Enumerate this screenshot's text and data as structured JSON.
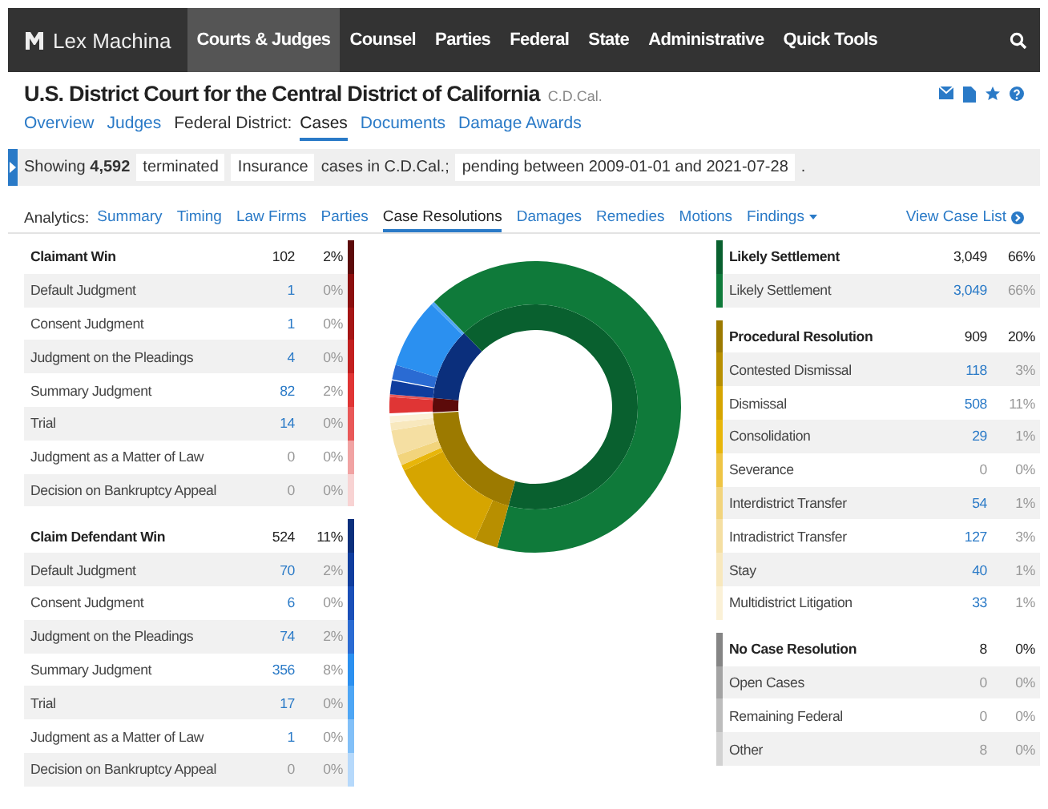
{
  "nav": {
    "logo": "Lex Machina",
    "items": [
      {
        "label": "Courts & Judges",
        "selected": true
      },
      {
        "label": "Counsel",
        "selected": false
      },
      {
        "label": "Parties",
        "selected": false
      },
      {
        "label": "Federal",
        "selected": false
      },
      {
        "label": "State",
        "selected": false
      },
      {
        "label": "Administrative",
        "selected": false
      },
      {
        "label": "Quick Tools",
        "selected": false
      }
    ]
  },
  "header": {
    "title": "U.S. District Court for the Central District of California",
    "abbreviation": "C.D.Cal.",
    "tabs": [
      {
        "kind": "link",
        "label": "Overview",
        "selected": false
      },
      {
        "kind": "link",
        "label": "Judges",
        "selected": false
      },
      {
        "kind": "label",
        "label": "Federal District:"
      },
      {
        "kind": "link",
        "label": "Cases",
        "selected": true
      },
      {
        "kind": "link",
        "label": "Documents",
        "selected": false
      },
      {
        "kind": "link",
        "label": "Damage Awards",
        "selected": false
      }
    ]
  },
  "filter": [
    {
      "kind": "text",
      "text": "Showing **4,592**"
    },
    {
      "kind": "chip",
      "text": "terminated"
    },
    {
      "kind": "chip",
      "text": "Insurance"
    },
    {
      "kind": "text",
      "text": "cases in C.D.Cal.;"
    },
    {
      "kind": "chip",
      "text": "pending between 2009-01-01 and 2021-07-28"
    },
    {
      "kind": "text",
      "text": "."
    }
  ],
  "analytics": {
    "label": "Analytics:",
    "tabs": [
      {
        "label": "Summary",
        "selected": false
      },
      {
        "label": "Timing",
        "selected": false
      },
      {
        "label": "Law Firms",
        "selected": false
      },
      {
        "label": "Parties",
        "selected": false
      },
      {
        "label": "Case Resolutions",
        "selected": true
      },
      {
        "label": "Damages",
        "selected": false
      },
      {
        "label": "Remedies",
        "selected": false
      },
      {
        "label": "Motions",
        "selected": false
      },
      {
        "label": "Findings",
        "selected": false
      }
    ],
    "view_case_list": "View Case List"
  },
  "left_groups": [
    {
      "label": "Claimant Win",
      "count": "102",
      "percent": "2%",
      "color": "#5c0a0a",
      "items": [
        {
          "label": "Default Judgment",
          "count": "1",
          "percent": "0%",
          "linked": true,
          "color": "#8b0e0e"
        },
        {
          "label": "Consent Judgment",
          "count": "1",
          "percent": "0%",
          "linked": true,
          "color": "#a51515"
        },
        {
          "label": "Judgment on the Pleadings",
          "count": "4",
          "percent": "0%",
          "linked": true,
          "color": "#c21f1f"
        },
        {
          "label": "Summary Judgment",
          "count": "82",
          "percent": "2%",
          "linked": true,
          "color": "#e03535"
        },
        {
          "label": "Trial",
          "count": "14",
          "percent": "0%",
          "linked": true,
          "color": "#e95858"
        },
        {
          "label": "Judgment as a Matter of Law",
          "count": "0",
          "percent": "0%",
          "linked": false,
          "color": "#f1a3a3"
        },
        {
          "label": "Decision on Bankruptcy Appeal",
          "count": "0",
          "percent": "0%",
          "linked": false,
          "color": "#f8d3d3"
        }
      ]
    },
    {
      "label": "Claim Defendant Win",
      "count": "524",
      "percent": "11%",
      "color": "#0b2f7c",
      "items": [
        {
          "label": "Default Judgment",
          "count": "70",
          "percent": "2%",
          "linked": true,
          "color": "#0f3d9e"
        },
        {
          "label": "Consent Judgment",
          "count": "6",
          "percent": "0%",
          "linked": true,
          "color": "#1a4fb8"
        },
        {
          "label": "Judgment on the Pleadings",
          "count": "74",
          "percent": "2%",
          "linked": true,
          "color": "#2a6bd3"
        },
        {
          "label": "Summary Judgment",
          "count": "356",
          "percent": "8%",
          "linked": true,
          "color": "#2b90f0"
        },
        {
          "label": "Trial",
          "count": "17",
          "percent": "0%",
          "linked": true,
          "color": "#4ea6f5"
        },
        {
          "label": "Judgment as a Matter of Law",
          "count": "1",
          "percent": "0%",
          "linked": true,
          "color": "#82c0f8"
        },
        {
          "label": "Decision on Bankruptcy Appeal",
          "count": "0",
          "percent": "0%",
          "linked": false,
          "color": "#b6d9fb"
        }
      ]
    }
  ],
  "right_groups": [
    {
      "label": "Likely Settlement",
      "count": "3,049",
      "percent": "66%",
      "color": "#09602f",
      "items": [
        {
          "label": "Likely Settlement",
          "count": "3,049",
          "percent": "66%",
          "linked": true,
          "color": "#0f7a3a"
        }
      ]
    },
    {
      "label": "Procedural Resolution",
      "count": "909",
      "percent": "20%",
      "color": "#9c7a00",
      "items": [
        {
          "label": "Contested Dismissal",
          "count": "118",
          "percent": "3%",
          "linked": true,
          "color": "#b88f00"
        },
        {
          "label": "Dismissal",
          "count": "508",
          "percent": "11%",
          "linked": true,
          "color": "#d6a500"
        },
        {
          "label": "Consolidation",
          "count": "29",
          "percent": "1%",
          "linked": true,
          "color": "#e8b60a"
        },
        {
          "label": "Severance",
          "count": "0",
          "percent": "0%",
          "linked": false,
          "color": "#efc545"
        },
        {
          "label": "Interdistrict Transfer",
          "count": "54",
          "percent": "1%",
          "linked": true,
          "color": "#f2d47c"
        },
        {
          "label": "Intradistrict Transfer",
          "count": "127",
          "percent": "3%",
          "linked": true,
          "color": "#f5dfa2"
        },
        {
          "label": "Stay",
          "count": "40",
          "percent": "1%",
          "linked": true,
          "color": "#f8e8bd"
        },
        {
          "label": "Multidistrict Litigation",
          "count": "33",
          "percent": "1%",
          "linked": true,
          "color": "#fbf1d7"
        }
      ]
    },
    {
      "label": "No Case Resolution",
      "count": "8",
      "percent": "0%",
      "color": "#858585",
      "items": [
        {
          "label": "Open Cases",
          "count": "0",
          "percent": "0%",
          "linked": false,
          "color": "#a3a3a3"
        },
        {
          "label": "Remaining Federal",
          "count": "0",
          "percent": "0%",
          "linked": false,
          "color": "#bdbdbd"
        },
        {
          "label": "Other",
          "count": "8",
          "percent": "0%",
          "linked": false,
          "color": "#d2d2d2"
        }
      ]
    }
  ]
}
